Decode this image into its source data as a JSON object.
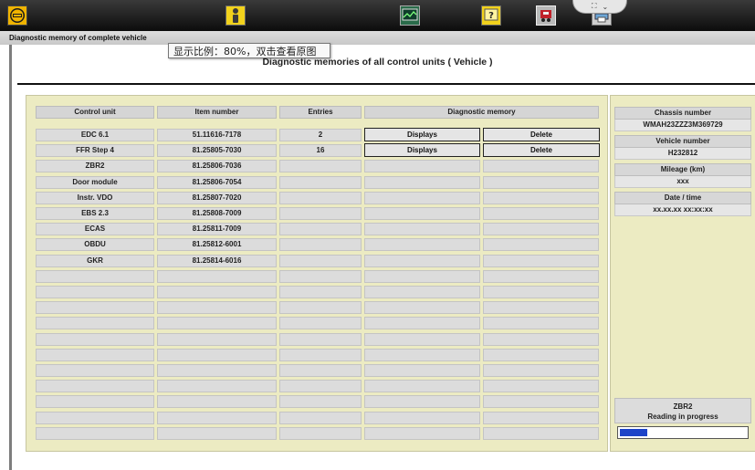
{
  "window": {
    "title": "Diagnostic memory of complete vehicle"
  },
  "toolbar": {
    "icons": [
      "man-logo-icon",
      "info-person-icon",
      "monitor-graph-icon",
      "help-icon",
      "vehicle-diagnosis-icon",
      "printer-icon"
    ],
    "tab_icons": [
      "expand-icon",
      "chevron-down-icon"
    ]
  },
  "tooltip": {
    "text": "显示比例：80%，双击查看原图"
  },
  "page": {
    "heading": "Diagnostic memories of all control units   ( Vehicle )"
  },
  "table": {
    "headers": [
      "Control unit",
      "Item number",
      "Entries",
      "Diagnostic memory"
    ],
    "rows": [
      {
        "unit": "EDC 6.1",
        "item": "51.11616-7178",
        "entries": "2",
        "display_label": "Displays",
        "delete_label": "Delete"
      },
      {
        "unit": "FFR Step 4",
        "item": "81.25805-7030",
        "entries": "16",
        "display_label": "Displays",
        "delete_label": "Delete"
      },
      {
        "unit": "ZBR2",
        "item": "81.25806-7036",
        "entries": ""
      },
      {
        "unit": "Door module",
        "item": "81.25806-7054",
        "entries": ""
      },
      {
        "unit": "Instr. VDO",
        "item": "81.25807-7020",
        "entries": ""
      },
      {
        "unit": "EBS 2.3",
        "item": "81.25808-7009",
        "entries": ""
      },
      {
        "unit": "ECAS",
        "item": "81.25811-7009",
        "entries": ""
      },
      {
        "unit": "OBDU",
        "item": "81.25812-6001",
        "entries": ""
      },
      {
        "unit": "GKR",
        "item": "81.25814-6016",
        "entries": ""
      }
    ],
    "empty_rows": 11
  },
  "vehicle_info": [
    {
      "label": "Chassis number",
      "value": "WMAH23ZZZ3M369729"
    },
    {
      "label": "Vehicle number",
      "value": "H232812"
    },
    {
      "label": "Mileage (km)",
      "value": "xxx"
    },
    {
      "label": "Date / time",
      "value": "xx.xx.xx   xx:xx:xx"
    }
  ],
  "status": {
    "unit": "ZBR2",
    "message": "Reading in progress",
    "progress": 0.22
  },
  "colors": {
    "panel_bg": "#ecebc2",
    "cell_bg": "#dcdcdc",
    "progress_fill": "#1d44c8",
    "toolbar_bg": "#1a1a1a"
  }
}
